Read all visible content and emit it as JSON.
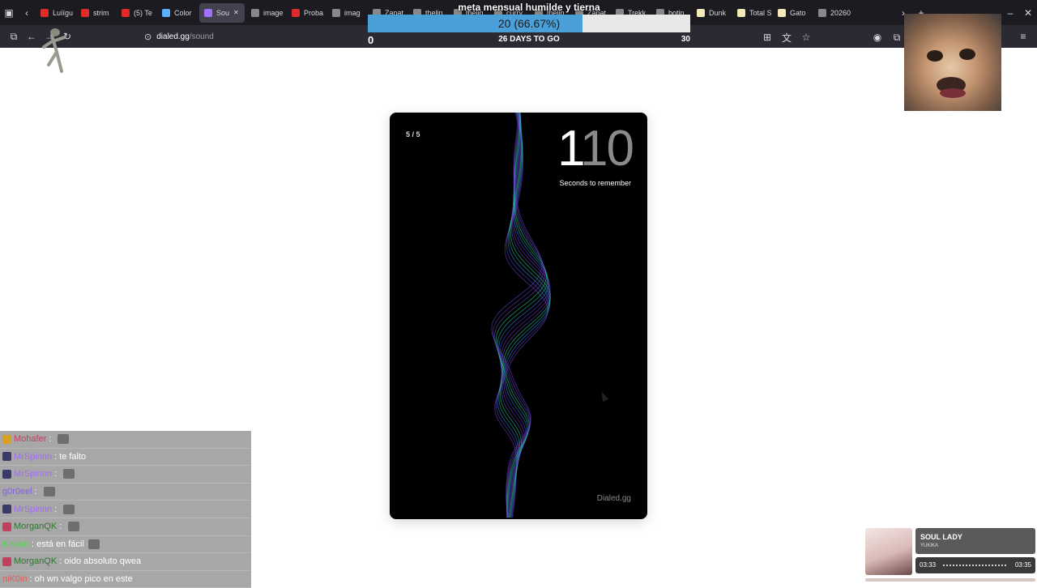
{
  "browser": {
    "tabs": [
      {
        "label": "Luíígu",
        "color": "#e02b2b"
      },
      {
        "label": "strim",
        "color": "#e02b2b"
      },
      {
        "label": "(5) Te",
        "color": "#e02b2b"
      },
      {
        "label": "Color",
        "color": "#5bb0ff"
      },
      {
        "label": "Sou",
        "color": "#a070ff",
        "active": true
      },
      {
        "label": "image",
        "color": "#888888"
      },
      {
        "label": "Proba",
        "color": "#e02b2b"
      },
      {
        "label": "imag",
        "color": "#888888"
      },
      {
        "label": "Zapat",
        "color": "#888888"
      },
      {
        "label": "thelin",
        "color": "#888888"
      },
      {
        "label": "thelin",
        "color": "#888888"
      },
      {
        "label": "curry",
        "color": "#888888"
      },
      {
        "label": "thelin",
        "color": "#888888"
      },
      {
        "label": "Zapat",
        "color": "#888888"
      },
      {
        "label": "Trekk",
        "color": "#888888"
      },
      {
        "label": "botin",
        "color": "#888888"
      },
      {
        "label": "Dunk",
        "color": "#f2e8b8"
      },
      {
        "label": "Total S",
        "color": "#f2e8b8"
      },
      {
        "label": "Gato",
        "color": "#f2e8b8"
      },
      {
        "label": "20260",
        "color": "#888888"
      }
    ],
    "url": {
      "domain": "dialed.gg",
      "path": "/sound"
    }
  },
  "goal": {
    "title": "meta mensual humilde y tierna",
    "value_label": "20 (66.67%)",
    "progress": 0.6667,
    "min": "0",
    "max": "30",
    "days_left": "26 DAYS TO GO"
  },
  "game": {
    "round": "5 / 5",
    "timer_bright": "1",
    "timer_dim": "10",
    "timer_label": "Seconds to remember",
    "brand": "Dialed.gg"
  },
  "chat": [
    {
      "user": "Mohafer",
      "user_color": "#c04060",
      "message": "",
      "badge": "#d8a020"
    },
    {
      "user": "MrSpinnn",
      "user_color": "#a070e8",
      "message": "te falto",
      "badge": "#3a3a6a"
    },
    {
      "user": "MrSpinnn",
      "user_color": "#a070e8",
      "message": "",
      "badge": "#3a3a6a"
    },
    {
      "user": "g0r0eel",
      "user_color": "#8060d8",
      "message": "",
      "badge": ""
    },
    {
      "user": "MrSpinnn",
      "user_color": "#a070e8",
      "message": "",
      "badge": "#3a3a6a"
    },
    {
      "user": "MorganQK",
      "user_color": "#2a7a2a",
      "message": "",
      "badge": "#c04060"
    },
    {
      "user": "Kissuh",
      "user_color": "#4cd84c",
      "message": "está en fácil",
      "badge": ""
    },
    {
      "user": "MorganQK",
      "user_color": "#2a7a2a",
      "message": "oido absoluto qwea",
      "badge": "#c04060"
    },
    {
      "user": "niK0in",
      "user_color": "#d86060",
      "message": "oh wn valgo pico en este",
      "badge": ""
    }
  ],
  "music": {
    "title": "SOUL LADY",
    "artist": "YUKIKA",
    "current": "03:33",
    "total": "03:35"
  }
}
